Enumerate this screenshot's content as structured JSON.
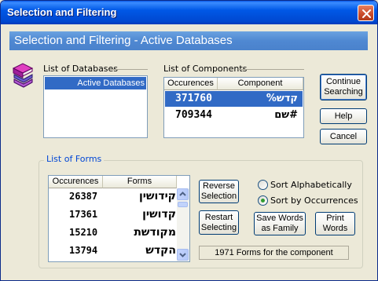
{
  "window": {
    "title": "Selection and Filtering"
  },
  "banner": {
    "text": "Selection and Filtering - Active Databases"
  },
  "databases": {
    "label": "List of Databases",
    "items": [
      {
        "label": "Active Databases",
        "selected": true
      }
    ]
  },
  "components": {
    "label": "List of Components",
    "columns": [
      "Occurences",
      "Component"
    ],
    "rows": [
      {
        "occurrences": "371760",
        "component": "קדש%",
        "selected": true
      },
      {
        "occurrences": "709344",
        "component": "#שם",
        "selected": false
      }
    ]
  },
  "forms": {
    "label": "List of Forms",
    "columns": [
      "Occurences",
      "Forms"
    ],
    "rows": [
      {
        "occurrences": "26387",
        "form": "קידושין"
      },
      {
        "occurrences": "17361",
        "form": "קדושין"
      },
      {
        "occurrences": "15210",
        "form": "מקודשת"
      },
      {
        "occurrences": "13794",
        "form": "הקדש"
      }
    ]
  },
  "buttons": {
    "continue_line1": "Continue",
    "continue_line2": "Searching",
    "help": "Help",
    "cancel": "Cancel",
    "reverse_line1": "Reverse",
    "reverse_line2": "Selection",
    "restart_line1": "Restart",
    "restart_line2": "Selecting",
    "save_line1": "Save Words",
    "save_line2": "as Family",
    "print_line1": "Print",
    "print_line2": "Words"
  },
  "sort": {
    "options": [
      {
        "label": "Sort Alphabetically",
        "selected": false
      },
      {
        "label": "Sort by Occurrences",
        "selected": true
      }
    ]
  },
  "status": {
    "text": "1971 Forms for the component"
  },
  "colors": {
    "title_blue": "#0058e6",
    "banner_blue": "#4f88d2",
    "selection_blue": "#316ac5"
  },
  "icons": [
    "books-icon",
    "close-icon",
    "scroll-up-icon",
    "scroll-down-icon"
  ]
}
